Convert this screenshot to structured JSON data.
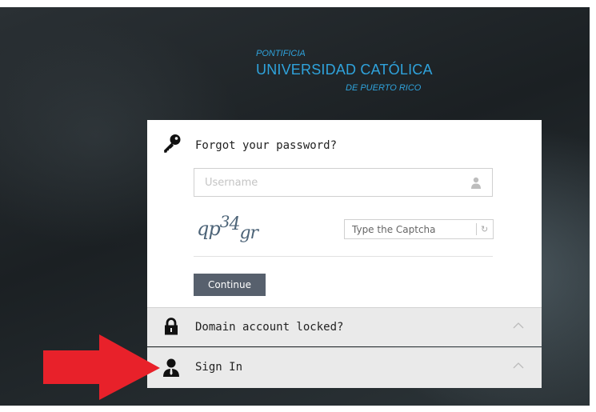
{
  "logo": {
    "line1": "PONTIFICIA",
    "line2": "UNIVERSIDAD CATÓLICA",
    "line3": "DE PUERTO RICO",
    "color": "#2fa3dc"
  },
  "forgot_password": {
    "title": "Forgot your password?",
    "icon": "key-icon",
    "username_placeholder": "Username",
    "username_value": "",
    "captcha_text": [
      "qp",
      "3",
      "4",
      "gr"
    ],
    "captcha_placeholder": "Type the Captcha",
    "captcha_value": "",
    "continue_label": "Continue",
    "button_color": "#57606d"
  },
  "panels": [
    {
      "label": "Domain account locked?",
      "icon": "lock-icon",
      "expanded": false
    },
    {
      "label": "Sign In",
      "icon": "person-icon",
      "expanded": false
    }
  ],
  "annotation": {
    "shape": "red-arrow",
    "color": "#e8212a",
    "points_to": "Sign In"
  }
}
